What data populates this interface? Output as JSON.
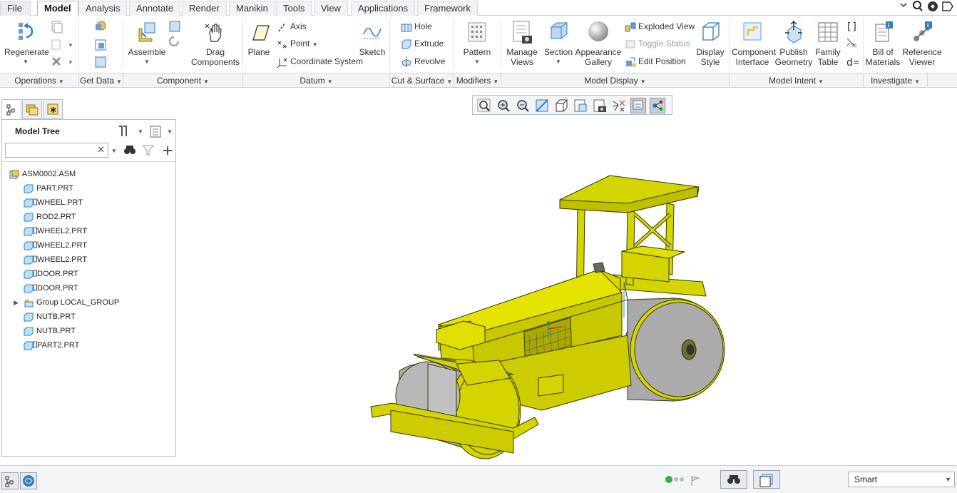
{
  "tabs": [
    "File",
    "Model",
    "Analysis",
    "Annotate",
    "Render",
    "Manikin",
    "Tools",
    "View",
    "Applications",
    "Framework"
  ],
  "active_tab": "Model",
  "ribbon": {
    "regenerate": "Regenerate",
    "assemble": "Assemble",
    "drag_components": "Drag Components",
    "plane": "Plane",
    "axis": "Axis",
    "point": "Point",
    "coordinate_system": "Coordinate System",
    "sketch": "Sketch",
    "hole": "Hole",
    "extrude": "Extrude",
    "revolve": "Revolve",
    "pattern": "Pattern",
    "manage_views": "Manage Views",
    "section": "Section",
    "appearance_gallery": "Appearance Gallery",
    "exploded_view": "Exploded View",
    "toggle_status": "Toggle Status",
    "edit_position": "Edit Position",
    "display_style": "Display Style",
    "component_interface": "Component Interface",
    "publish_geometry": "Publish Geometry",
    "family_table": "Family Table",
    "bill_of_materials": "Bill of Materials",
    "reference_viewer": "Reference Viewer"
  },
  "groups": [
    "Operations",
    "Get Data",
    "Component",
    "Datum",
    "Cut & Surface",
    "Modifiers",
    "Model Display",
    "Model Intent",
    "Investigate"
  ],
  "model_tree": {
    "title": "Model Tree",
    "search_placeholder": "",
    "items": [
      {
        "label": "ASM0002.ASM",
        "type": "assembly"
      },
      {
        "label": "PART.PRT",
        "type": "part"
      },
      {
        "label": "WHEEL.PRT",
        "type": "part-flag"
      },
      {
        "label": "ROD2.PRT",
        "type": "part"
      },
      {
        "label": "WHEEL2.PRT",
        "type": "part-flag"
      },
      {
        "label": "WHEEL2.PRT",
        "type": "part-flag"
      },
      {
        "label": "WHEEL2.PRT",
        "type": "part-flag"
      },
      {
        "label": "DOOR.PRT",
        "type": "part-flag"
      },
      {
        "label": "DOOR.PRT",
        "type": "part-flag"
      },
      {
        "label": "Group LOCAL_GROUP",
        "type": "group"
      },
      {
        "label": "NUTB.PRT",
        "type": "part"
      },
      {
        "label": "NUTB.PRT",
        "type": "part"
      },
      {
        "label": "PART2.PRT",
        "type": "part-flag"
      }
    ]
  },
  "status": {
    "filter": "Smart"
  },
  "colors": {
    "model_yellow": "#d4d400",
    "roller_gray": "#a9a9a9",
    "accent_blue": "#2f7fc1"
  }
}
